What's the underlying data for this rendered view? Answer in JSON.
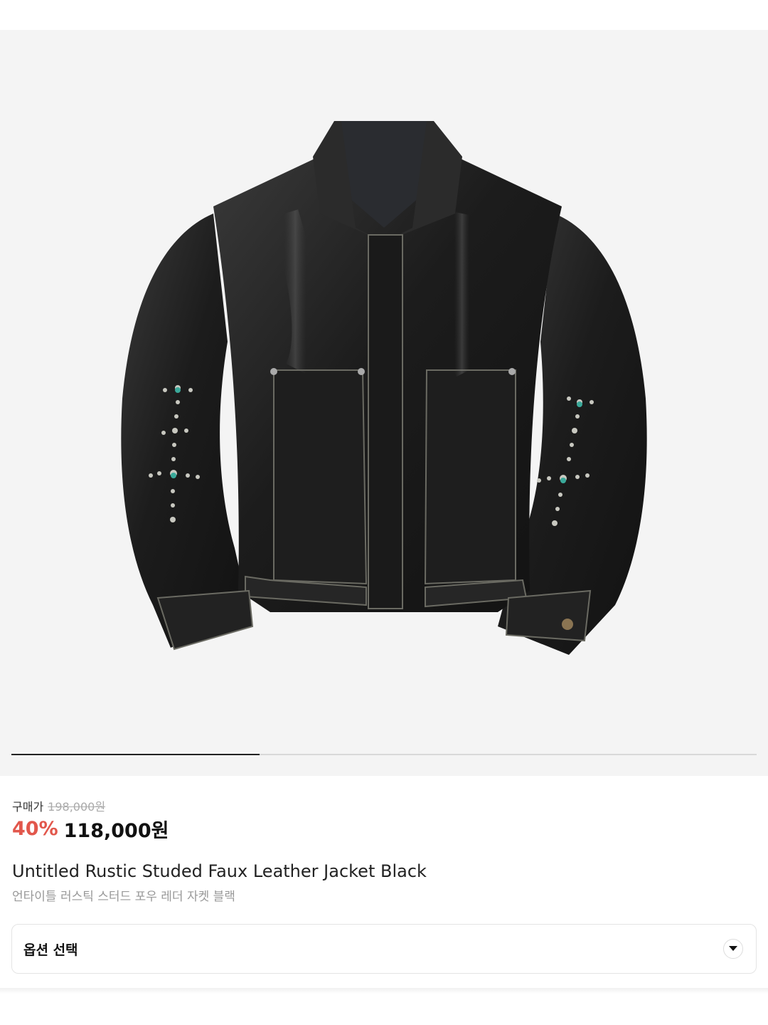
{
  "product": {
    "image_icon": "leather-jacket-image",
    "gallery_progress": 0.333
  },
  "price": {
    "label": "구매가",
    "original": "198,000원",
    "discount": "40%",
    "sale": "118,000원"
  },
  "name": {
    "en": "Untitled Rustic Studed Faux Leather Jacket Black",
    "ko": "언타이틀 러스틱 스터드 포우 레더 자켓 블랙"
  },
  "option": {
    "label": "옵션 선택",
    "icon": "chevron-down-icon"
  },
  "colors": {
    "discount": "#e2574c",
    "gallery_bg": "#f4f4f4"
  }
}
